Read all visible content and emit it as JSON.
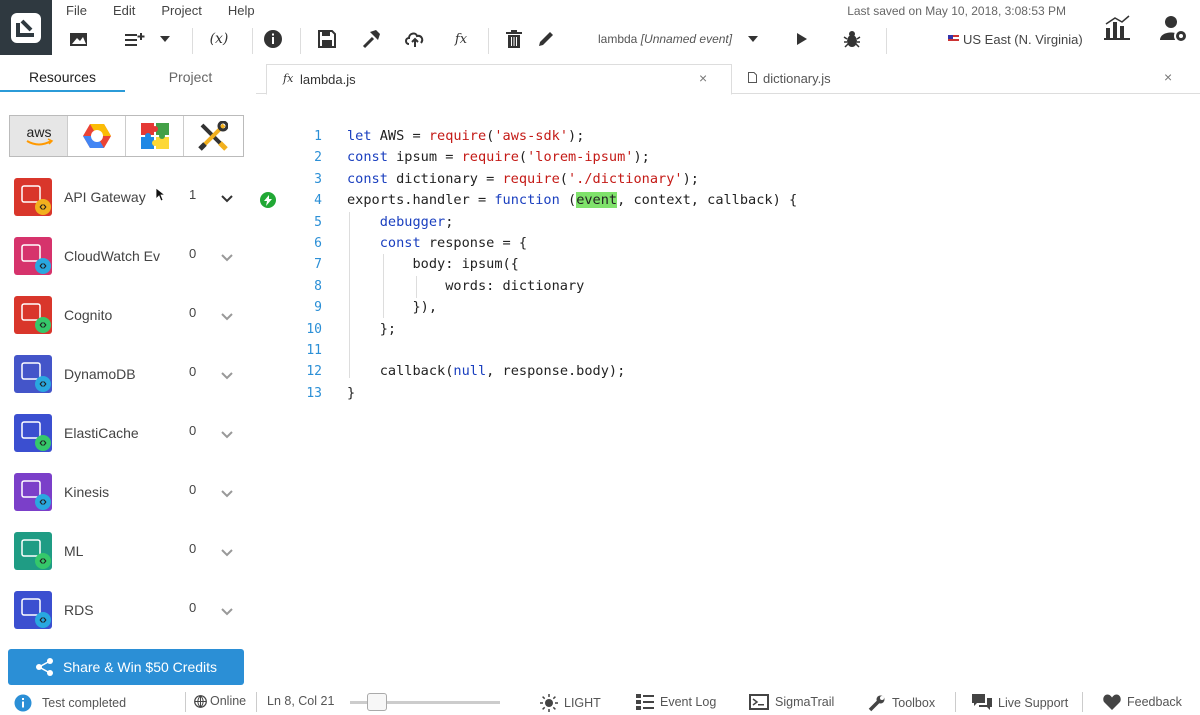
{
  "menu": [
    "File",
    "Edit",
    "Project",
    "Help"
  ],
  "last_saved": "Last saved on May 10, 2018, 3:08:53 PM",
  "toolbar": {
    "event_func": "lambda",
    "event_name": "[Unnamed event]",
    "region": "US East (N. Virginia)"
  },
  "left_tabs": [
    "Resources",
    "Project"
  ],
  "providers": [
    "aws",
    "google-cloud",
    "integrations",
    "tools"
  ],
  "resources": [
    {
      "name": "API Gateway",
      "count": "1",
      "color": "#d9362b"
    },
    {
      "name": "CloudWatch Ev",
      "count": "0",
      "color": "#d6336c"
    },
    {
      "name": "Cognito",
      "count": "0",
      "color": "#d9362b"
    },
    {
      "name": "DynamoDB",
      "count": "0",
      "color": "#4455c9"
    },
    {
      "name": "ElastiCache",
      "count": "0",
      "color": "#3b4fd0"
    },
    {
      "name": "Kinesis",
      "count": "0",
      "color": "#7b3fc9"
    },
    {
      "name": "ML",
      "count": "0",
      "color": "#1f9c84"
    },
    {
      "name": "RDS",
      "count": "0",
      "color": "#3b4fd0"
    }
  ],
  "share_label": "Share & Win $50 Credits",
  "tabs": [
    {
      "label": "lambda.js",
      "icon": "fx"
    },
    {
      "label": "dictionary.js",
      "icon": "file"
    }
  ],
  "code_lines": [
    "1",
    "2",
    "3",
    "4",
    "5",
    "6",
    "7",
    "8",
    "9",
    "10",
    "11",
    "12",
    "13"
  ],
  "status": {
    "test": "Test completed",
    "online": "Online",
    "position": "Ln 8, Col 21",
    "theme": "LIGHT",
    "event_log": "Event Log",
    "sigmatrail": "SigmaTrail",
    "toolbox": "Toolbox",
    "live_support": "Live Support",
    "feedback": "Feedback"
  },
  "colors": {
    "accent": "#2b8fd6",
    "active_line": "#21a835",
    "highlight": "#7fe26b"
  }
}
